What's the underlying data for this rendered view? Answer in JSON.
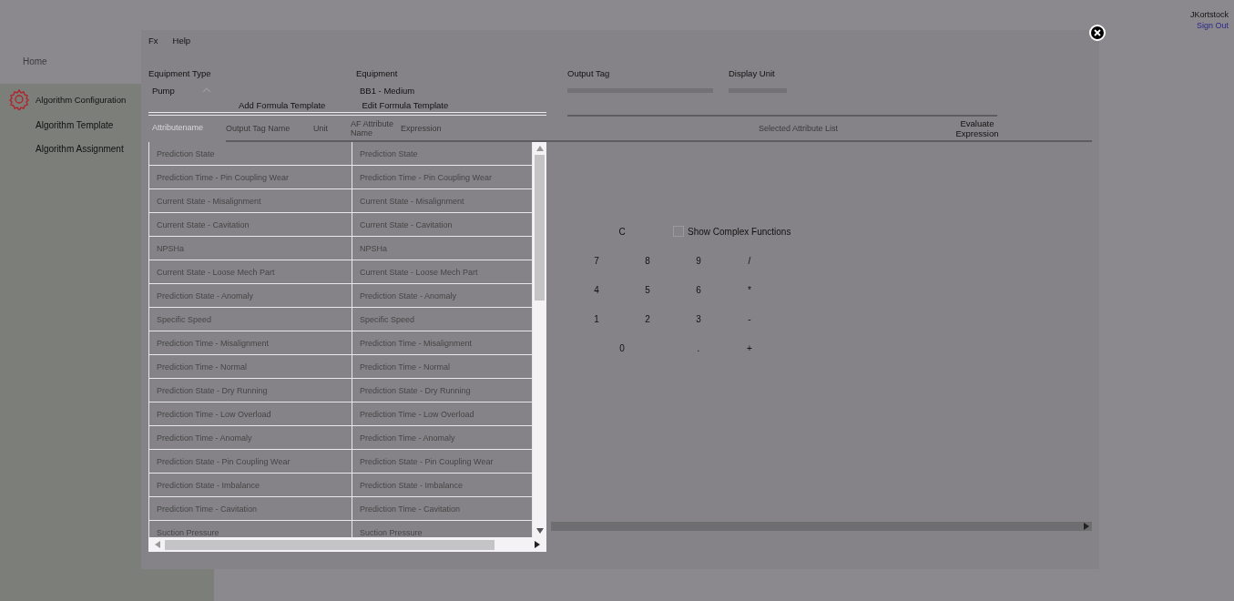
{
  "user": {
    "name": "JKortstock",
    "sign_out": "Sign Out"
  },
  "sidebar": {
    "home": "Home",
    "section": "Algorithm Configuration",
    "items": [
      "Algorithm Template",
      "Algorithm Assignment"
    ]
  },
  "dialog": {
    "menu": [
      "Fx",
      "Help"
    ],
    "fields": [
      {
        "label": "Equipment Type",
        "value": "Pump",
        "kind": "select"
      },
      {
        "label": "Equipment",
        "value": "BB1 - Medium",
        "kind": "text"
      },
      {
        "label": "Output Tag",
        "kind": "input"
      },
      {
        "label": "Display Unit",
        "kind": "input"
      }
    ],
    "buttons": [
      "Add Formula Template",
      "Edit Formula Template"
    ],
    "grid_columns": [
      "Output Tag Name",
      "Unit",
      "AF Attribute Name",
      "Expression"
    ],
    "selected_attribute_list": "Selected Attribute List",
    "evaluate_button": "Evaluate Expression",
    "keypad": {
      "clear": "C",
      "rows": [
        [
          "7",
          "8",
          "9",
          "/"
        ],
        [
          "4",
          "5",
          "6",
          "*"
        ],
        [
          "1",
          "2",
          "3",
          "-"
        ],
        [
          "0",
          "",
          ".",
          "+"
        ]
      ]
    },
    "complex_functions": {
      "label": "Show Complex Functions",
      "checked": false
    },
    "dropdown": {
      "header": "Attributename",
      "rows": [
        [
          "Prediction State",
          "Prediction State"
        ],
        [
          "Prediction Time - Pin Coupling Wear",
          "Prediction Time - Pin Coupling Wear"
        ],
        [
          "Current State - Misalignment",
          "Current State - Misalignment"
        ],
        [
          "Current State - Cavitation",
          "Current State - Cavitation"
        ],
        [
          "NPSHa",
          "NPSHa"
        ],
        [
          "Current State - Loose Mech Part",
          "Current State - Loose Mech Part"
        ],
        [
          "Prediction State - Anomaly",
          "Prediction State - Anomaly"
        ],
        [
          "Specific Speed",
          "Specific Speed"
        ],
        [
          "Prediction Time - Misalignment",
          "Prediction Time - Misalignment"
        ],
        [
          "Prediction Time - Normal",
          "Prediction Time - Normal"
        ],
        [
          "Prediction State - Dry Running",
          "Prediction State - Dry Running"
        ],
        [
          "Prediction Time - Low Overload",
          "Prediction Time - Low Overload"
        ],
        [
          "Prediction Time - Anomaly",
          "Prediction Time - Anomaly"
        ],
        [
          "Prediction State - Pin Coupling Wear",
          "Prediction State - Pin Coupling Wear"
        ],
        [
          "Prediction State - Imbalance",
          "Prediction State - Imbalance"
        ],
        [
          "Prediction Time - Cavitation",
          "Prediction Time - Cavitation"
        ],
        [
          "Suction Pressure",
          "Suction Pressure"
        ]
      ]
    }
  }
}
